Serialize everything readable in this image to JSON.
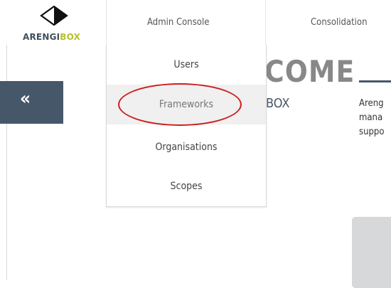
{
  "brand": {
    "name_part1": "ARENGI",
    "name_part2": "BOX"
  },
  "nav": {
    "items": [
      {
        "label": "Admin Console"
      },
      {
        "label": "Consolidation"
      }
    ]
  },
  "dropdown": {
    "items": [
      {
        "label": "Users"
      },
      {
        "label": "Frameworks"
      },
      {
        "label": "Organisations"
      },
      {
        "label": "Scopes"
      }
    ],
    "highlighted_index": 1
  },
  "hero": {
    "title_fragment": "COME",
    "subtitle_fragment": "BOX",
    "text_lines": [
      "Areng",
      "mana",
      "suppo"
    ]
  },
  "collapse": {
    "glyph": "«"
  },
  "colors": {
    "brand_dark": "#46576a",
    "brand_accent": "#b6c22c",
    "annotation": "#cc1f1f"
  }
}
